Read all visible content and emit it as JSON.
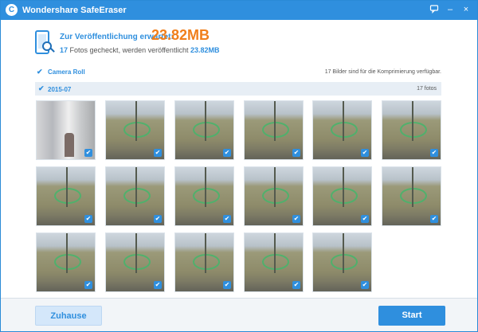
{
  "app": {
    "title": "Wondershare SafeEraser",
    "logo_letter": "C"
  },
  "titlebar": {
    "feedback_icon": "message-icon",
    "minimize_label": "–",
    "close_label": "×"
  },
  "summary": {
    "label": "Zur Veröffentlichung erwartet:",
    "size": "23.82MB",
    "count": "17",
    "line2_middle": "Fotos gecheckt, werden veröffentlicht",
    "line2_size": "23.82MB"
  },
  "album": {
    "name": "Camera Roll",
    "note": "17 Bilder sind für die Komprimierung verfügbar."
  },
  "group": {
    "name": "2015-07",
    "count": "17 fotos"
  },
  "photos": [
    {
      "scene": "hall"
    },
    {
      "scene": "field"
    },
    {
      "scene": "field"
    },
    {
      "scene": "field"
    },
    {
      "scene": "field"
    },
    {
      "scene": "field"
    },
    {
      "scene": "field"
    },
    {
      "scene": "field"
    },
    {
      "scene": "field"
    },
    {
      "scene": "field"
    },
    {
      "scene": "field"
    },
    {
      "scene": "field"
    },
    {
      "scene": "field"
    },
    {
      "scene": "field"
    },
    {
      "scene": "field"
    },
    {
      "scene": "field"
    },
    {
      "scene": "field"
    }
  ],
  "check_glyph": "✔",
  "footer": {
    "home_label": "Zuhause",
    "start_label": "Start"
  },
  "colors": {
    "accent": "#2f8fde",
    "highlight": "#f07f1b"
  }
}
